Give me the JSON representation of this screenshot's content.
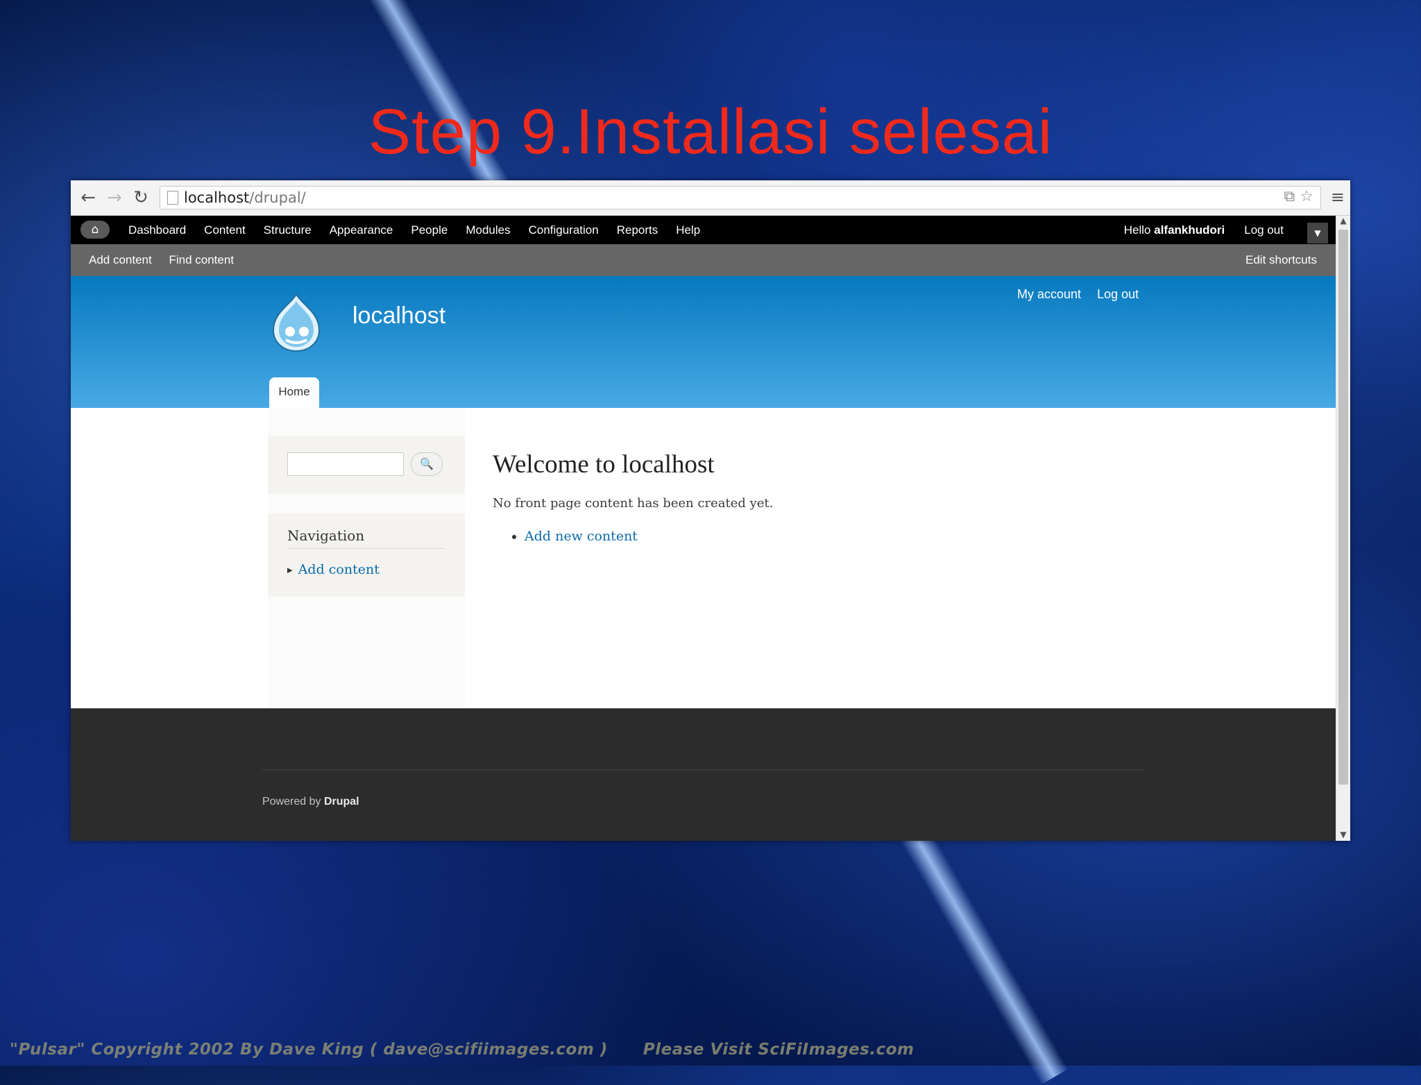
{
  "slide": {
    "title": "Step 9.Installasi selesai",
    "copyright": "\"Pulsar\" Copyright 2002 By Dave King ( dave@scifiimages.com )      Please Visit SciFiImages.com"
  },
  "browser": {
    "back_icon": "←",
    "forward_icon": "→",
    "reload_icon": "↻",
    "url_host": "localhost",
    "url_path": "/drupal/",
    "translate_icon": "⧉",
    "star_icon": "☆",
    "menu_icon": "≡"
  },
  "toolbar": {
    "home_icon": "⌂",
    "menu": [
      "Dashboard",
      "Content",
      "Structure",
      "Appearance",
      "People",
      "Modules",
      "Configuration",
      "Reports",
      "Help"
    ],
    "hello_prefix": "Hello",
    "username": "alfankhudori",
    "logout": "Log out",
    "toggle_icon": "▼"
  },
  "shortcuts": {
    "items": [
      "Add content",
      "Find content"
    ],
    "edit": "Edit shortcuts"
  },
  "header": {
    "site_name": "localhost",
    "secondary_menu": [
      "My account",
      "Log out"
    ],
    "main_tab": "Home"
  },
  "sidebar": {
    "search_button_icon": "🔍",
    "nav_title": "Navigation",
    "nav_item": "Add content",
    "nav_bullet": "▶"
  },
  "main": {
    "title": "Welcome to localhost",
    "message": "No front page content has been created yet.",
    "link": "Add new content"
  },
  "footer": {
    "powered_prefix": "Powered by",
    "powered_link": "Drupal"
  },
  "colors": {
    "title_red": "#ef2a1c",
    "header_top": "#0779bf",
    "header_bottom": "#48a9e4",
    "link_blue": "#0b6aa8",
    "footer_bg": "#2d2c2d"
  }
}
